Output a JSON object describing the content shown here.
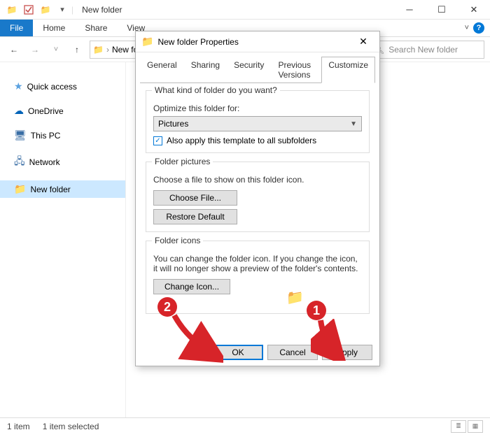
{
  "explorer": {
    "title": "New folder",
    "file_tab": "File",
    "tabs": [
      "Home",
      "Share",
      "View"
    ],
    "breadcrumb": "New fo",
    "search_placeholder": "Search New folder",
    "status_items": "1 item",
    "status_selected": "1 item selected"
  },
  "navpane": {
    "quick_access": "Quick access",
    "onedrive": "OneDrive",
    "this_pc": "This PC",
    "network": "Network",
    "new_folder": "New folder"
  },
  "dialog": {
    "title": "New folder Properties",
    "tabs": [
      "General",
      "Sharing",
      "Security",
      "Previous Versions",
      "Customize"
    ],
    "group1": {
      "title": "What kind of folder do you want?",
      "optimize_label": "Optimize this folder for:",
      "dropdown_value": "Pictures",
      "checkbox_label": "Also apply this template to all subfolders",
      "checkbox_checked": true
    },
    "group2": {
      "title": "Folder pictures",
      "desc": "Choose a file to show on this folder icon.",
      "choose": "Choose File...",
      "restore": "Restore Default"
    },
    "group3": {
      "title": "Folder icons",
      "desc": "You can change the folder icon. If you change the icon, it will no longer show a preview of the folder's contents.",
      "change": "Change Icon..."
    },
    "ok": "OK",
    "cancel": "Cancel",
    "apply": "Apply"
  },
  "annotations": {
    "one": "1",
    "two": "2"
  }
}
